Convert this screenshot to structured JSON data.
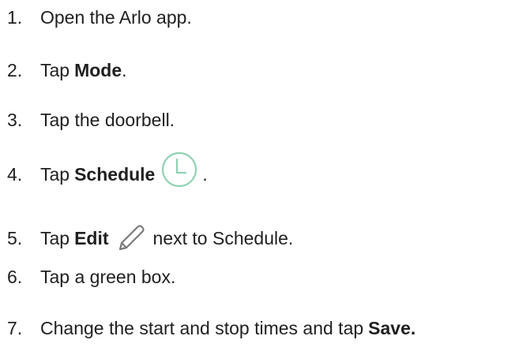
{
  "steps": [
    {
      "number": "1.",
      "text": "Open the Arlo app."
    },
    {
      "number": "2.",
      "pre": "Tap",
      "bold": "Mode",
      "post": "."
    },
    {
      "number": "3.",
      "text": "Tap the doorbell."
    },
    {
      "number": "4.",
      "pre": "Tap",
      "bold": "Schedule",
      "icon": "clock-icon",
      "post": "."
    },
    {
      "number": "5.",
      "pre": "Tap",
      "bold": "Edit",
      "icon": "pencil-icon",
      "post": "next to Schedule."
    },
    {
      "number": "6.",
      "text": "Tap a green box."
    },
    {
      "number": "7.",
      "pre": "Change the start and stop times and tap",
      "bold": "Save."
    }
  ],
  "colors": {
    "text": "#1f1f1f",
    "clock_icon": "#8fd1b2",
    "pencil_icon": "#7a7a7a"
  }
}
